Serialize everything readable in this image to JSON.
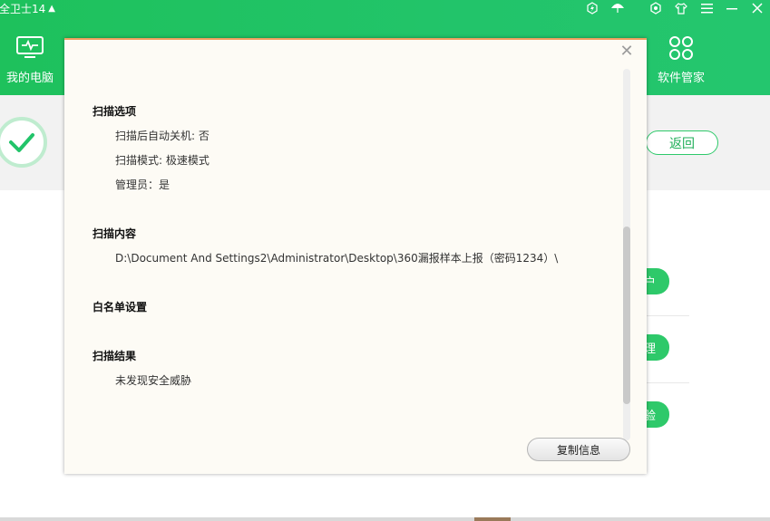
{
  "app": {
    "title": "全卫士14",
    "nav": [
      {
        "label": "我的电脑",
        "icon": "monitor-icon"
      },
      {
        "label": "",
        "icon": "shield-icon"
      },
      {
        "label": "",
        "icon": "sweep-icon"
      },
      {
        "label": "",
        "icon": "tools-icon"
      },
      {
        "label": "",
        "icon": "speed-icon"
      },
      {
        "label": "",
        "icon": "shield-icon"
      }
    ],
    "nav_right": {
      "label": "软件管家",
      "icon": "app-store-icon"
    },
    "return_label": "返回",
    "pill_labels": [
      "户",
      "理",
      "验"
    ]
  },
  "dialog": {
    "sections": [
      {
        "title": "扫描选项",
        "lines": [
          "扫描后自动关机: 否",
          "扫描模式: 极速模式",
          "管理员：是"
        ]
      },
      {
        "title": "扫描内容",
        "lines": [
          "D:\\Document And Settings2\\Administrator\\Desktop\\360漏报样本上报（密码1234）\\"
        ]
      },
      {
        "title": "白名单设置",
        "lines": []
      },
      {
        "title": "扫描结果",
        "lines": [
          "未发现安全威胁"
        ]
      }
    ],
    "copy_button": "复制信息"
  },
  "colors": {
    "brand": "#22c46a",
    "accent": "#f0a060"
  }
}
